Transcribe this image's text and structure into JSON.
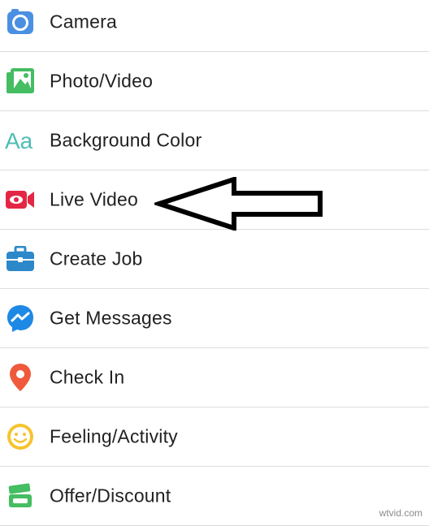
{
  "menu": {
    "items": [
      {
        "label": "Camera",
        "icon": "camera-icon",
        "color": "#4a90e2"
      },
      {
        "label": "Photo/Video",
        "icon": "photo-video-icon",
        "color": "#45bd62"
      },
      {
        "label": "Background Color",
        "icon": "text-aa-icon",
        "color": "#4fbdb4"
      },
      {
        "label": "Live Video",
        "icon": "live-video-icon",
        "color": "#e42645"
      },
      {
        "label": "Create Job",
        "icon": "briefcase-icon",
        "color": "#2d88c9"
      },
      {
        "label": "Get Messages",
        "icon": "messenger-icon",
        "color": "#1e88e5"
      },
      {
        "label": "Check In",
        "icon": "location-pin-icon",
        "color": "#f05a3c"
      },
      {
        "label": "Feeling/Activity",
        "icon": "smiley-icon",
        "color": "#f7c32e"
      },
      {
        "label": "Offer/Discount",
        "icon": "tag-icon",
        "color": "#45bd62"
      }
    ]
  },
  "watermark": "wtvid.com"
}
